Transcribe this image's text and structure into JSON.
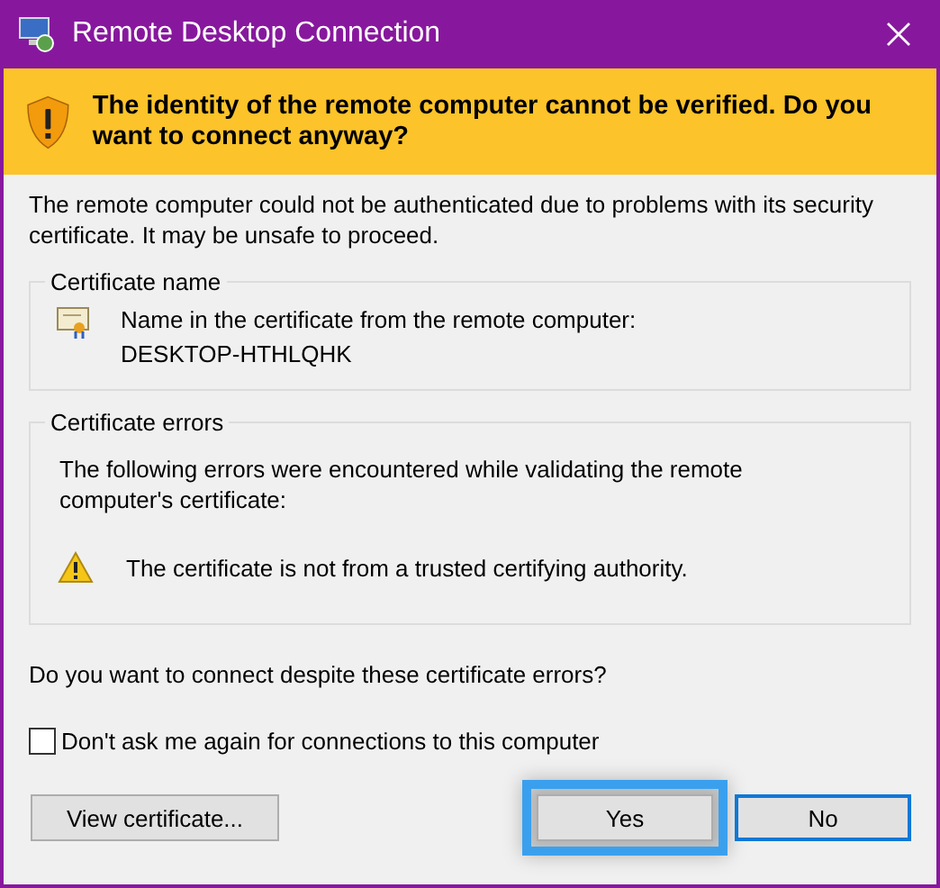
{
  "window": {
    "title": "Remote Desktop Connection"
  },
  "banner": {
    "text": "The identity of the remote computer cannot be verified. Do you want to connect anyway?"
  },
  "intro": "The remote computer could not be authenticated due to problems with its security certificate. It may be unsafe to proceed.",
  "certificate_name": {
    "title": "Certificate name",
    "label": "Name in the certificate from the remote computer:",
    "value": "DESKTOP-HTHLQHK"
  },
  "certificate_errors": {
    "title": "Certificate errors",
    "description": "The following errors were encountered while validating the remote computer's certificate:",
    "errors": [
      "The certificate is not from a trusted certifying authority."
    ]
  },
  "question": "Do you want to connect despite these certificate errors?",
  "dont_ask": {
    "label": "Don't ask me again for connections to this computer",
    "checked": false
  },
  "buttons": [
    {
      "label": "View certificate...",
      "default": false,
      "highlighted": false
    },
    {
      "label": "Yes",
      "default": false,
      "highlighted": true
    },
    {
      "label": "No",
      "default": true,
      "highlighted": false
    }
  ]
}
